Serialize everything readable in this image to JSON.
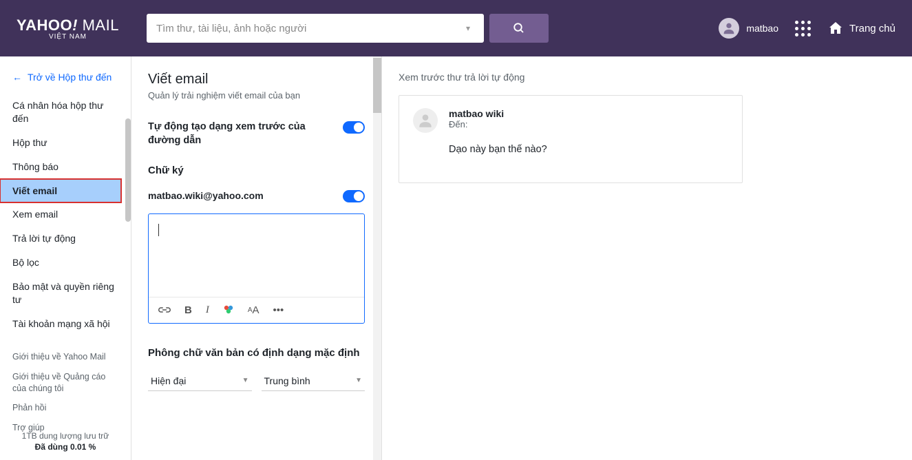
{
  "brand": {
    "main": "YAHOO",
    "mail": "MAIL",
    "region": "VIỆT NAM"
  },
  "search": {
    "placeholder": "Tìm thư, tài liệu, ảnh hoặc người"
  },
  "header": {
    "user": "matbao",
    "home": "Trang chủ"
  },
  "sidebar": {
    "back": "Trở về Hộp thư đến",
    "items": [
      "Cá nhân hóa hộp thư đến",
      "Hộp thư",
      "Thông báo",
      "Viết email",
      "Xem email",
      "Trả lời tự động",
      "Bộ lọc",
      "Bảo mật và quyền riêng tư",
      "Tài khoản mạng xã hội"
    ],
    "sub": [
      "Giới thiệu về Yahoo Mail",
      "Giới thiệu về Quảng cáo của chúng tôi",
      "Phản hồi",
      "Trợ giúp"
    ],
    "storage": {
      "cap": "1TB dung lượng lưu trữ",
      "used": "Đã dùng 0.01 %"
    }
  },
  "settings": {
    "title": "Viết email",
    "subtitle": "Quản lý trải nghiệm viết email của bạn",
    "autoPreview": "Tự động tạo dạng xem trước của đường dẫn",
    "signature": "Chữ ký",
    "sigEmail": "matbao.wiki@yahoo.com",
    "fontHeader": "Phông chữ văn bản có định dạng mặc định",
    "fontFamily": "Hiện đại",
    "fontSize": "Trung bình"
  },
  "preview": {
    "title": "Xem trước thư trả lời tự động",
    "from": "matbao wiki",
    "to": "Đến:",
    "body": "Dạo này bạn thế nào?"
  }
}
